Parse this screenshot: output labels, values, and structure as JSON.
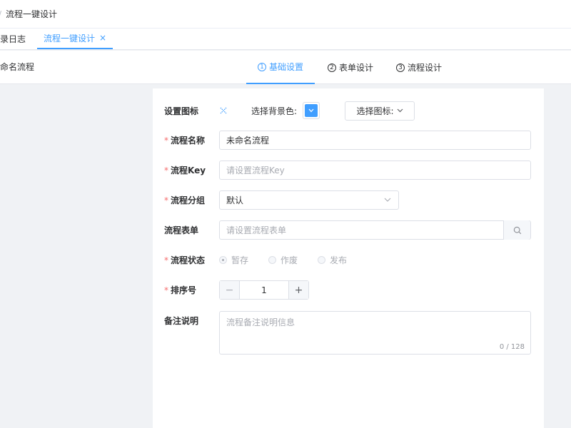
{
  "breadcrumb": {
    "separator": "/",
    "current": "流程一键设计"
  },
  "tabs": [
    {
      "label": "录日志"
    },
    {
      "label": "流程一键设计",
      "close": "×"
    }
  ],
  "header": {
    "flow_title": "命名流程"
  },
  "steps": [
    {
      "num": "1",
      "label": "基础设置"
    },
    {
      "num": "2",
      "label": "表单设计"
    },
    {
      "num": "3",
      "label": "流程设计"
    }
  ],
  "form": {
    "icon": {
      "label": "设置图标",
      "bg_label": "选择背景色:",
      "bg_color": "#409eff",
      "icon_select_label": "选择图标:"
    },
    "name": {
      "label": "流程名称",
      "value": "未命名流程"
    },
    "key": {
      "label": "流程Key",
      "placeholder": "请设置流程Key"
    },
    "group": {
      "label": "流程分组",
      "value": "默认"
    },
    "form_table": {
      "label": "流程表单",
      "placeholder": "请设置流程表单"
    },
    "status": {
      "label": "流程状态",
      "options": [
        "暂存",
        "作废",
        "发布"
      ],
      "selected": "暂存"
    },
    "sort": {
      "label": "排序号",
      "value": "1"
    },
    "remark": {
      "label": "备注说明",
      "placeholder": "流程备注说明信息",
      "counter": "0 / 128"
    }
  },
  "icons": {
    "required_marker": "*",
    "chevron": "chevron-down-icon",
    "search": "search-icon",
    "minus": "−",
    "plus": "+"
  }
}
